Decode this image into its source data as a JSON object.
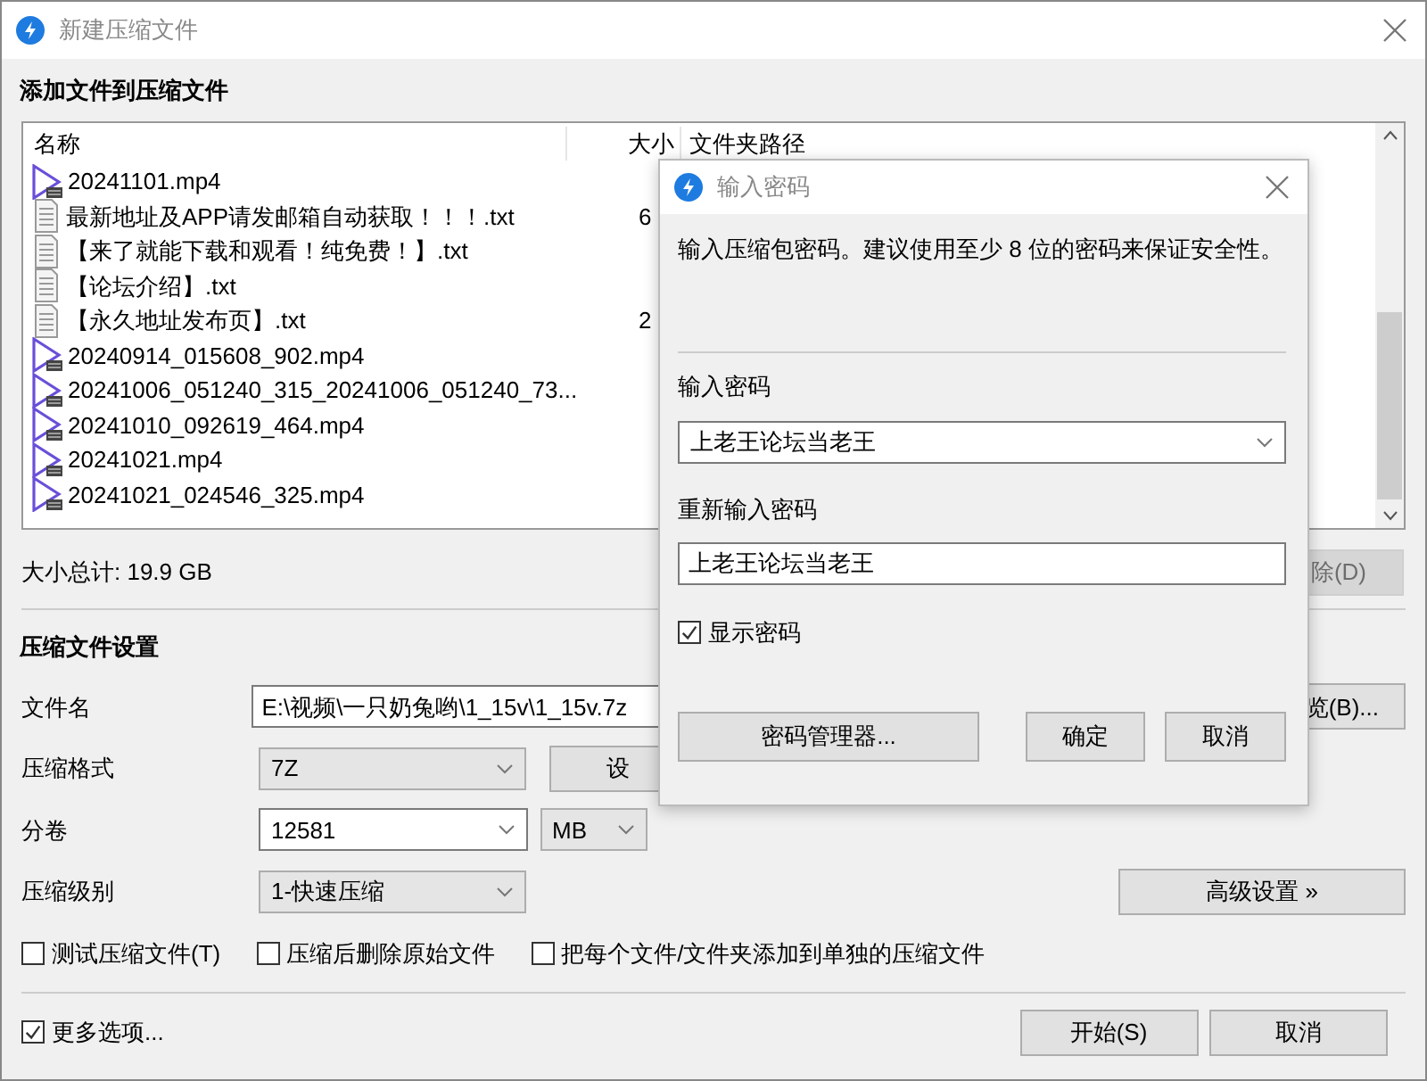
{
  "window": {
    "title": "新建压缩文件"
  },
  "add_section": {
    "heading": "添加文件到压缩文件"
  },
  "file_list": {
    "columns": [
      "名称",
      "大小",
      "文件夹路径"
    ],
    "rows": [
      {
        "kind": "video",
        "name": "20241101.mp4"
      },
      {
        "kind": "text",
        "name": "最新地址及APP请发邮箱自动获取！！！.txt",
        "size": "6"
      },
      {
        "kind": "text",
        "name": "【来了就能下载和观看！纯免费！】.txt"
      },
      {
        "kind": "text",
        "name": "【论坛介绍】.txt"
      },
      {
        "kind": "text",
        "name": "【永久地址发布页】.txt",
        "size": "2"
      },
      {
        "kind": "video",
        "name": "20240914_015608_902.mp4"
      },
      {
        "kind": "video",
        "name": "20241006_051240_315_20241006_051240_73..."
      },
      {
        "kind": "video",
        "name": "20241010_092619_464.mp4"
      },
      {
        "kind": "video",
        "name": "20241021.mp4"
      },
      {
        "kind": "video",
        "name": "20241021_024546_325.mp4"
      }
    ]
  },
  "total_size": "大小总计: 19.9 GB",
  "remove_button": {
    "label": "除(D)",
    "disabled": true
  },
  "settings": {
    "heading": "压缩文件设置",
    "filename": {
      "label": "文件名",
      "value": "E:\\视频\\一只奶兔哟\\1_15v\\1_15v.7z"
    },
    "browse_button": "览(B)...",
    "format": {
      "label": "压缩格式",
      "value": "7Z",
      "editable": false
    },
    "format_settings_button": "设",
    "volume": {
      "label": "分卷",
      "value": "12581",
      "editable": true
    },
    "volume_unit": {
      "value": "MB",
      "editable": false
    },
    "level": {
      "label": "压缩级别",
      "value": "1-快速压缩",
      "editable": false
    },
    "advanced_button": "高级设置 »",
    "options": [
      {
        "label": "测试压缩文件(T)",
        "checked": false
      },
      {
        "label": "压缩后删除原始文件",
        "checked": false
      },
      {
        "label": "把每个文件/文件夹添加到单独的压缩文件",
        "checked": false
      }
    ]
  },
  "more_options": {
    "label": "更多选项...",
    "checked": true
  },
  "buttons": [
    "开始(S)",
    "取消"
  ],
  "password_dialog": {
    "title": "输入密码",
    "description": "输入压缩包密码。建议使用至少 8 位的密码来保证安全性。",
    "password_label": "输入密码",
    "password": "上老王论坛当老王",
    "confirm_label": "重新输入密码",
    "confirm": "上老王论坛当老王",
    "show_password": {
      "label": "显示密码",
      "checked": true
    },
    "buttons": [
      "密码管理器...",
      "确定",
      "取消"
    ]
  }
}
